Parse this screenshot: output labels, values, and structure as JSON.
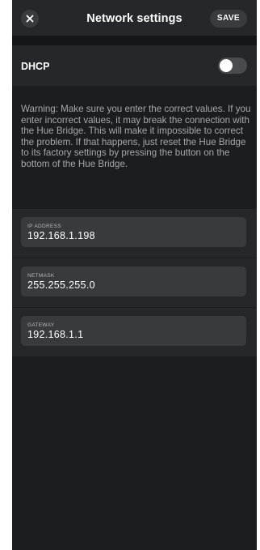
{
  "header": {
    "title": "Network settings",
    "save_label": "SAVE"
  },
  "dhcp": {
    "label": "DHCP",
    "enabled": false
  },
  "warning": "Warning: Make sure you enter the correct values. If you enter incorrect values, it may break the connection with the Hue Bridge. This will make it impossible to correct the problem. If that happens, just reset the Hue Bridge to its factory settings by pressing the button on the bottom of the Hue Bridge.",
  "fields": {
    "ip": {
      "label": "IP ADDRESS",
      "value": "192.168.1.198"
    },
    "netmask": {
      "label": "NETMASK",
      "value": "255.255.255.0"
    },
    "gateway": {
      "label": "GATEWAY",
      "value": "192.168.1.1"
    }
  }
}
